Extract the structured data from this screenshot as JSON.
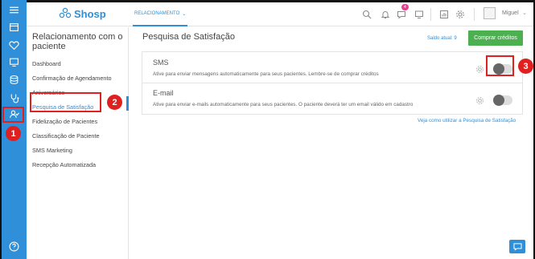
{
  "app": {
    "logo_text": "Shosp"
  },
  "topbar": {
    "tab_label": "RELACIONAMENTO",
    "notification_badge": "4",
    "user_name": "Miguel"
  },
  "rail": {
    "icons": [
      "menu-icon",
      "calendar-icon",
      "heart-icon",
      "monitor-icon",
      "database-icon",
      "stethoscope-icon",
      "relationship-icon",
      "help-icon"
    ]
  },
  "sidebar": {
    "title": "Relacionamento com o paciente",
    "items": [
      {
        "label": "Dashboard"
      },
      {
        "label": "Confirmação de Agendamento"
      },
      {
        "label": "Aniversários"
      },
      {
        "label": "Pesquisa de Satisfação"
      },
      {
        "label": "Fidelização de Pacientes"
      },
      {
        "label": "Classificação de Paciente"
      },
      {
        "label": "SMS Marketing"
      },
      {
        "label": "Recepção Automatizada"
      }
    ],
    "active_index": 3
  },
  "content": {
    "title": "Pesquisa de Satisfação",
    "saldo": "Saldo atual: 9",
    "buy_button": "Comprar créditos",
    "options": [
      {
        "title": "SMS",
        "description": "Ative para enviar mensagens automaticamente para seus pacientes. Lembre-se de comprar créditos",
        "enabled": false
      },
      {
        "title": "E-mail",
        "description": "Ative para enviar e-mails automaticamente para seus pacientes. O paciente deverá ter um email válido em cadastro",
        "enabled": false
      }
    ],
    "help_link": "Veja como utilizar a Pesquisa de Satisfação"
  },
  "annotations": [
    {
      "number": "1"
    },
    {
      "number": "2"
    },
    {
      "number": "3"
    }
  ],
  "colors": {
    "accent": "#2f8fd8",
    "buy": "#4caf50",
    "annotation": "#e02020"
  }
}
